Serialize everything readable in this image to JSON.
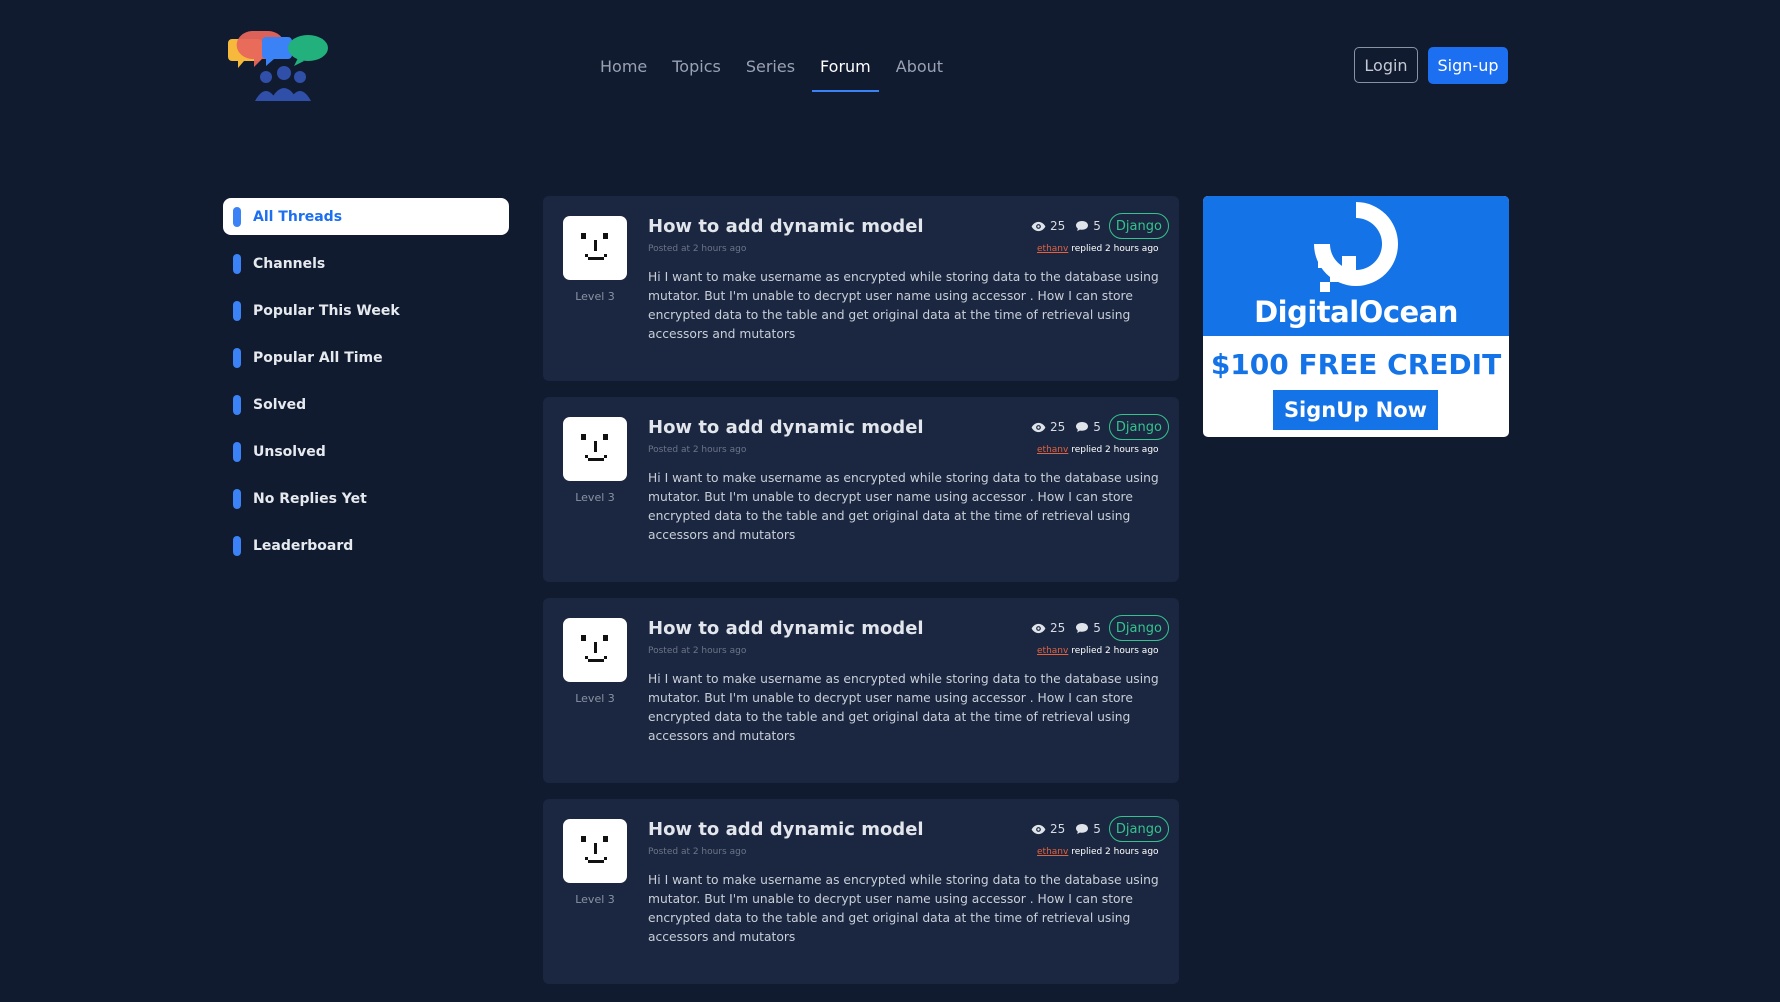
{
  "nav": {
    "items": [
      {
        "label": "Home",
        "active": false
      },
      {
        "label": "Topics",
        "active": false
      },
      {
        "label": "Series",
        "active": false
      },
      {
        "label": "Forum",
        "active": true
      },
      {
        "label": "About",
        "active": false
      }
    ],
    "login_label": "Login",
    "signup_label": "Sign-up"
  },
  "sidebar": {
    "items": [
      {
        "label": "All Threads",
        "active": true
      },
      {
        "label": "Channels",
        "active": false
      },
      {
        "label": "Popular This Week",
        "active": false
      },
      {
        "label": "Popular All Time",
        "active": false
      },
      {
        "label": "Solved",
        "active": false
      },
      {
        "label": "Unsolved",
        "active": false
      },
      {
        "label": "No Replies Yet",
        "active": false
      },
      {
        "label": "Leaderboard",
        "active": false
      }
    ]
  },
  "threads": [
    {
      "title": "How to add dynamic model",
      "posted": "Posted at 2 hours ago",
      "level": "Level 3",
      "views": "25",
      "replies": "5",
      "tag": "Django",
      "reply_user": "ethanv",
      "reply_text": " replied 2 hours ago",
      "excerpt": "Hi I want to make username as encrypted while storing data to the database using mutator. But I'm unable to decrypt user name using accessor . How I can store encrypted data to the table and get original data at the time of retrieval using accessors and mutators"
    },
    {
      "title": "How to add dynamic model",
      "posted": "Posted at 2 hours ago",
      "level": "Level 3",
      "views": "25",
      "replies": "5",
      "tag": "Django",
      "reply_user": "ethanv",
      "reply_text": " replied 2 hours ago",
      "excerpt": "Hi I want to make username as encrypted while storing data to the database using mutator. But I'm unable to decrypt user name using accessor . How I can store encrypted data to the table and get original data at the time of retrieval using accessors and mutators"
    },
    {
      "title": "How to add dynamic model",
      "posted": "Posted at 2 hours ago",
      "level": "Level 3",
      "views": "25",
      "replies": "5",
      "tag": "Django",
      "reply_user": "ethanv",
      "reply_text": " replied 2 hours ago",
      "excerpt": "Hi I want to make username as encrypted while storing data to the database using mutator. But I'm unable to decrypt user name using accessor . How I can store encrypted data to the table and get original data at the time of retrieval using accessors and mutators"
    },
    {
      "title": "How to add dynamic model",
      "posted": "Posted at 2 hours ago",
      "level": "Level 3",
      "views": "25",
      "replies": "5",
      "tag": "Django",
      "reply_user": "ethanv",
      "reply_text": " replied 2 hours ago",
      "excerpt": "Hi I want to make username as encrypted while storing data to the database using mutator. But I'm unable to decrypt user name using accessor . How I can store encrypted data to the table and get original data at the time of retrieval using accessors and mutators"
    }
  ],
  "ad": {
    "brand": "DigitalOcean",
    "credit": "$100 FREE CREDIT",
    "cta": "SignUp Now"
  },
  "icons": {
    "logo": "chat-bubbles-community-logo",
    "views": "eye-icon",
    "comments": "comment-icon",
    "avatar": "pixel-face-avatar",
    "ad_logo": "digitalocean-logo"
  },
  "colors": {
    "background": "#111b30",
    "card": "#1b2740",
    "accent": "#1d6ff2",
    "tag": "#34c38f",
    "reply_user": "#e0623f",
    "ad_blue": "#1473e6"
  }
}
